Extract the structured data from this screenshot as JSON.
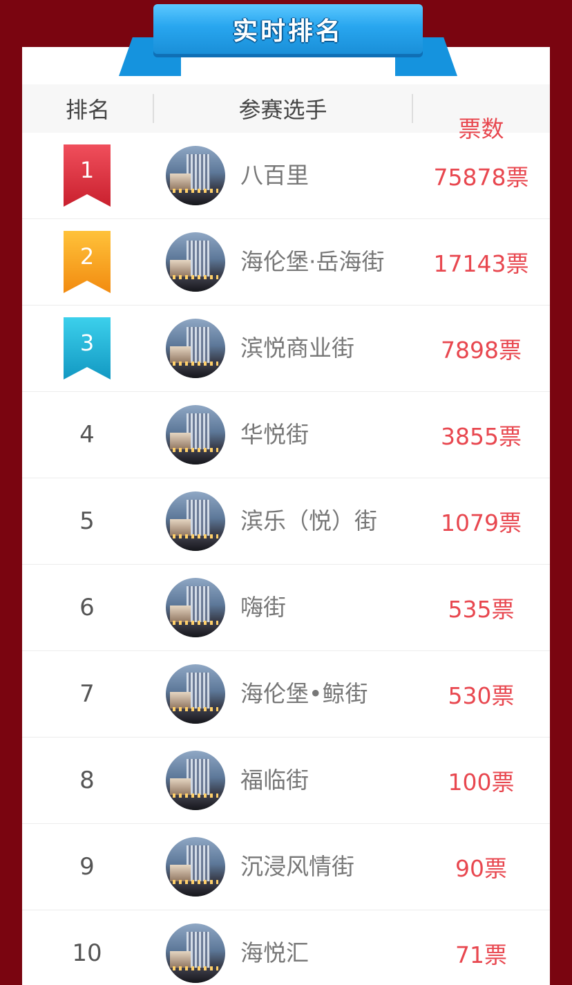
{
  "banner": {
    "title": "实时排名"
  },
  "header": {
    "rank": "排名",
    "player": "参赛选手",
    "votes": "票数"
  },
  "colors": {
    "background": "#7a0510",
    "vote_text": "#e8474f",
    "banner": "#28a6ef"
  },
  "rows": [
    {
      "rank": "1",
      "name": "八百里",
      "votes": "75878票"
    },
    {
      "rank": "2",
      "name": "海伦堡·岳海街",
      "votes": "17143票"
    },
    {
      "rank": "3",
      "name": "滨悦商业街",
      "votes": "7898票"
    },
    {
      "rank": "4",
      "name": "华悦街",
      "votes": "3855票"
    },
    {
      "rank": "5",
      "name": "滨乐（悦）街",
      "votes": "1079票"
    },
    {
      "rank": "6",
      "name": "嗨街",
      "votes": "535票"
    },
    {
      "rank": "7",
      "name": "海伦堡•鲸街",
      "votes": "530票"
    },
    {
      "rank": "8",
      "name": "福临街",
      "votes": "100票"
    },
    {
      "rank": "9",
      "name": "沉浸风情街",
      "votes": "90票"
    },
    {
      "rank": "10",
      "name": "海悦汇",
      "votes": "71票"
    }
  ]
}
